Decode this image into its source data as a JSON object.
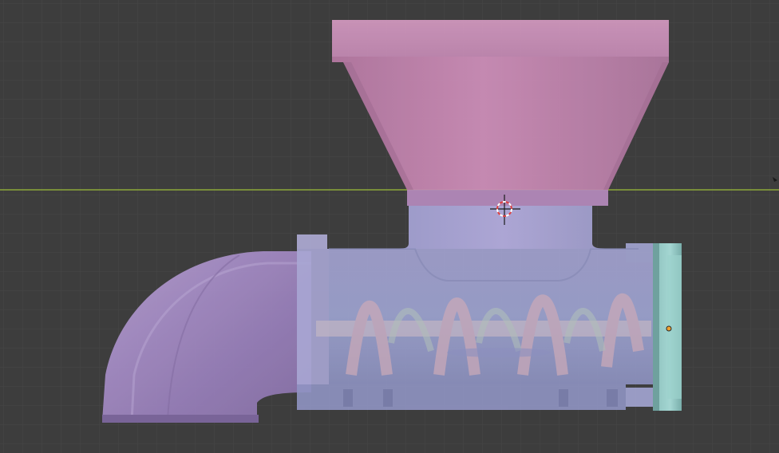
{
  "viewport": {
    "background": "#3d3d3d",
    "grid_minor_color": "#474747",
    "grid_major_color": "#4a4a4a",
    "x_axis_color": "#8ca83a",
    "view": "orthographic-front"
  },
  "objects": [
    {
      "name": "hopper",
      "color": "#c48ab4"
    },
    {
      "name": "elbow-outlet",
      "color": "#a58bc4"
    },
    {
      "name": "barrel-housing",
      "color": "#a5a8d6"
    },
    {
      "name": "auger-screw",
      "color": "#c9a9b8"
    },
    {
      "name": "end-cap",
      "color": "#8fc4c0"
    }
  ],
  "cursor": {
    "name": "3d-cursor-icon",
    "ring_color_a": "#ffffff",
    "ring_color_b": "#e04040"
  },
  "origin": {
    "name": "object-origin-icon",
    "color": "#f0a030"
  }
}
